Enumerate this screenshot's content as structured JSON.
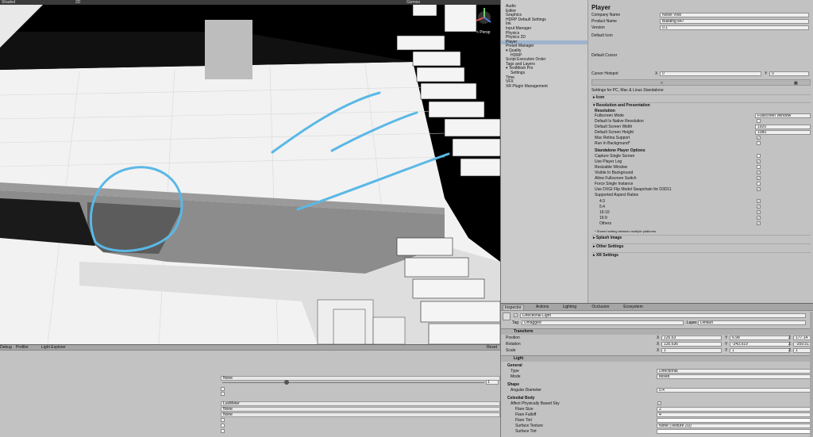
{
  "scene": {
    "toolbar": {
      "shading": "Shaded",
      "mode_2d": "2D",
      "gizmos": "Gizmos",
      "persp": "< Persp"
    }
  },
  "settings": {
    "nav_items": [
      "Audio",
      "Editor",
      "Graphics",
      "HDRP Default Settings",
      "Ink",
      "Input Manager",
      "Physics",
      "Physics 2D",
      "Player",
      "Preset Manager",
      "Quality",
      "HDRP",
      "Script Execution Order",
      "Tags and Layers",
      "TextMesh Pro",
      "Settings",
      "Time",
      "VFX",
      "XR Plugin Management"
    ],
    "selected_nav": "Player",
    "title": "Player",
    "company_name_label": "Company Name",
    "company_name": "Noise Void",
    "product_name_label": "Product Name",
    "product_name": "Building 847",
    "version_label": "Version",
    "version": "0.1",
    "default_icon_label": "Default Icon",
    "default_cursor_label": "Default Cursor",
    "cursor_hotspot_label": "Cursor Hotspot",
    "hotspot_x_label": "X",
    "hotspot_x": "0",
    "hotspot_y_label": "Y",
    "hotspot_y": "0",
    "platform_caption": "Settings for PC, Mac & Linux Standalone",
    "icon_section": "Icon",
    "resolution_section": "Resolution and Presentation",
    "resolution_sub": "Resolution",
    "fullscreen_mode_label": "Fullscreen Mode",
    "fullscreen_mode": "Fullscreen Window",
    "default_native_label": "Default Is Native Resolution",
    "screen_width_label": "Default Screen Width",
    "screen_width": "1920",
    "screen_height_label": "Default Screen Height",
    "screen_height": "1080",
    "mac_retina_label": "Mac Retina Support",
    "run_bg_label": "Run In Background*",
    "standalone_sub": "Standalone Player Options",
    "capture_single_label": "Capture Single Screen",
    "player_log_label": "Use Player Log",
    "resizable_label": "Resizable Window",
    "visible_bg_label": "Visible In Background",
    "fs_switch_label": "Allow Fullscreen Switch",
    "single_instance_label": "Force Single Instance",
    "dxgi_label": "Use DXGI Flip Model Swapchain for D3D11",
    "aspect_label": "Supported Aspect Ratios",
    "aspect_4_3": "4:3",
    "aspect_5_4": "5:4",
    "aspect_16_10": "16:10",
    "aspect_16_9": "16:9",
    "aspect_others": "Others",
    "shared_note": "* Shared setting between multiple platforms.",
    "splash_section": "Splash Image",
    "other_section": "Other Settings",
    "xr_section": "XR Settings"
  },
  "inspector": {
    "tabs": [
      "Inspector",
      "Actions",
      "Lighting",
      "Occlusion",
      "Ecosystem"
    ],
    "object_name": "Directional Light",
    "tag_label": "Tag",
    "tag": "Untagged",
    "layer_label": "Layer",
    "layer": "Default",
    "transform_label": "Transform",
    "position_label": "Position",
    "rotation_label": "Rotation",
    "scale_label": "Scale",
    "x_label": "X",
    "y_label": "Y",
    "z_label": "Z",
    "position": {
      "x": "126.63",
      "y": "6.98",
      "z": "177.14"
    },
    "rotation": {
      "x": "135.636",
      "y": "-343.919",
      "z": "-359.517"
    },
    "scale": {
      "x": "1",
      "y": "1",
      "z": "1"
    },
    "light_label": "Light",
    "general_sub": "General",
    "type_label": "Type",
    "type": "Directional",
    "mode_label": "Mode",
    "mode": "Mixed",
    "shape_sub": "Shape",
    "angular_label": "Angular Diameter",
    "angular": "0.4",
    "celestial_label": "Celestial Body",
    "affect_sky_label": "Affect Physically Based Sky",
    "flare_size_label": "Flare Size",
    "flare_size": "2",
    "flare_falloff_label": "Flare Falloff",
    "flare_falloff": "4",
    "flare_tint_label": "Flare Tint",
    "surface_tex_label": "Surface Texture",
    "surface_tex": "None (Texture 2D)",
    "surface_tint_label": "Surface Tint"
  },
  "debug": {
    "tabs": [
      "Debug",
      "Profiler",
      "Light Explorer"
    ],
    "reset": "Reset",
    "field1": "None",
    "slider_value": "1",
    "field_lux": "LuxMeter",
    "field_none2": "None",
    "field_none3": "None"
  }
}
